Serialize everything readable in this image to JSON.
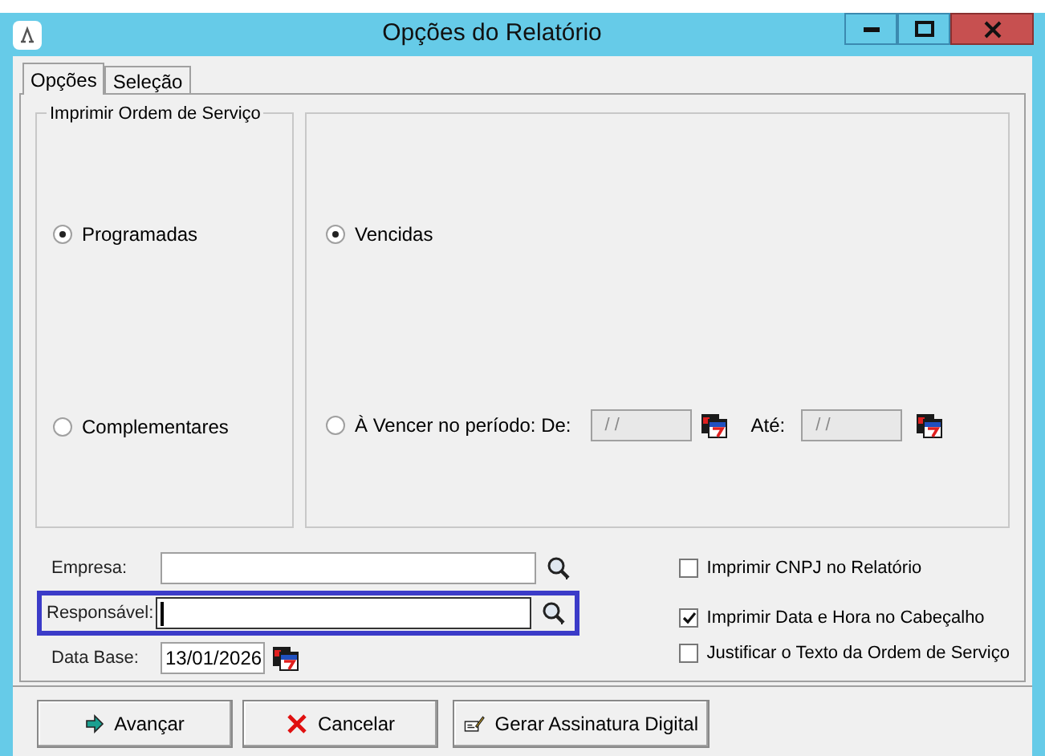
{
  "window": {
    "title": "Opções do Relatório"
  },
  "tabs": [
    {
      "label": "Opções",
      "selected": true
    },
    {
      "label": "Seleção",
      "selected": false
    }
  ],
  "print_group": {
    "title": "Imprimir Ordem de Serviço",
    "options": [
      {
        "label": "Programadas",
        "selected": true
      },
      {
        "label": "Complementares",
        "selected": false
      }
    ]
  },
  "due_group": {
    "options": [
      {
        "label": "Vencidas",
        "selected": true
      },
      {
        "label": "À Vencer no período: De:",
        "selected": false
      }
    ],
    "from_date": {
      "value": "/ /",
      "disabled": true
    },
    "to_label": "Até:",
    "to_date": {
      "value": "/ /",
      "disabled": true
    }
  },
  "fields": [
    {
      "label": "Empresa:",
      "kind": "lookup",
      "highlighted": false,
      "focused": false
    },
    {
      "label": "Responsável:",
      "kind": "lookup",
      "highlighted": true,
      "focused": true
    },
    {
      "label": "Data Base:",
      "kind": "date",
      "value": "13/01/2026"
    }
  ],
  "checkboxes": [
    {
      "label": "Imprimir CNPJ no Relatório",
      "checked": false
    },
    {
      "label": "Imprimir Data e Hora no Cabeçalho",
      "checked": true
    },
    {
      "label": "Justificar o Texto da Ordem de Serviço",
      "checked": false
    }
  ],
  "buttons": [
    {
      "label": "Avançar",
      "kind": "forward"
    },
    {
      "label": "Cancelar",
      "kind": "cancel"
    },
    {
      "label": "Gerar Assinatura Digital",
      "kind": "sign"
    }
  ]
}
